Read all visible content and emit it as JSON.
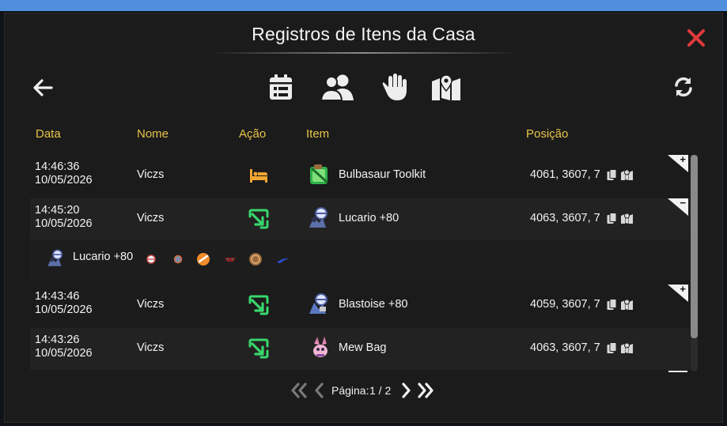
{
  "window": {
    "title": "Registros de Itens da Casa"
  },
  "filters": {
    "icons": [
      "calendar-icon",
      "users-icon",
      "hand-icon",
      "map-pin-icon"
    ]
  },
  "columns": {
    "date": "Data",
    "name": "Nome",
    "action": "Ação",
    "item": "Item",
    "position": "Posição"
  },
  "rows": [
    {
      "time": "14:46:36",
      "date": "10/05/2026",
      "name": "Viczs",
      "action_icon": "bed-icon",
      "item_icon": "toolkit-icon",
      "item": "Bulbasaur Toolkit",
      "position": "4061, 3607, 7",
      "expand": "+"
    },
    {
      "time": "14:45:20",
      "date": "10/05/2026",
      "name": "Viczs",
      "action_icon": "arrow-in-icon",
      "item_icon": "pokeball-item-icon",
      "item": "Lucario +80",
      "position": "4063, 3607, 7",
      "expand": "−"
    },
    {
      "time": "14:43:46",
      "date": "10/05/2026",
      "name": "Viczs",
      "action_icon": "arrow-in-icon",
      "item_icon": "pokeball-item-icon",
      "item": "Blastoise +80",
      "position": "4059, 3607, 7",
      "expand": "+"
    },
    {
      "time": "14:43:26",
      "date": "10/05/2026",
      "name": "Viczs",
      "action_icon": "arrow-in-icon",
      "item_icon": "bag-icon",
      "item": "Mew Bag",
      "position": "4063, 3607, 7",
      "expand": ""
    }
  ],
  "detail": {
    "item": "Lucario +80",
    "held_items": [
      "pokeball-icon",
      "orb-icon",
      "stone-icon",
      "berry-icon",
      "shell-icon",
      "feather-icon"
    ]
  },
  "pagination": {
    "label": "Página:",
    "value": "1 / 2"
  },
  "colors": {
    "accent_header": "#e9c54a",
    "action_green": "#38d66b",
    "action_orange": "#f0a630",
    "close_red": "#e03a3a"
  }
}
